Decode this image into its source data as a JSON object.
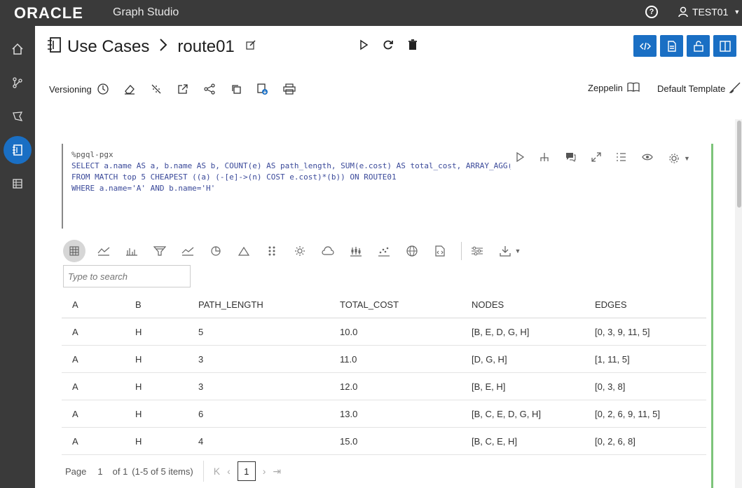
{
  "app": {
    "brand": "ORACLE",
    "product": "Graph Studio",
    "user": "TEST01"
  },
  "rail": {
    "items": [
      "home-icon",
      "graph-icon",
      "model-icon",
      "notebook-icon",
      "jobs-icon"
    ],
    "active_index": 3
  },
  "header": {
    "crumb_parent": "Use Cases",
    "crumb_current": "route01"
  },
  "toolbar": {
    "versioning_label": "Versioning",
    "zeppelin_label": "Zeppelin",
    "template_label": "Default Template"
  },
  "editor": {
    "lines": [
      "%pgql-pgx",
      "SELECT a.name AS a, b.name AS b, COUNT(e) AS path_length, SUM(e.cost) AS total_cost, ARRAY_AGG(...",
      "FROM MATCH top 5 CHEAPEST ((a) (-[e]->(n) COST e.cost)*(b)) ON ROUTE01",
      "WHERE a.name='A' AND b.name='H'"
    ]
  },
  "search": {
    "placeholder": "Type to search"
  },
  "table": {
    "columns": [
      "A",
      "B",
      "PATH_LENGTH",
      "TOTAL_COST",
      "NODES",
      "EDGES"
    ],
    "rows": [
      [
        "A",
        "H",
        "5",
        "10.0",
        "[B, E, D, G, H]",
        "[0, 3, 9, 11, 5]"
      ],
      [
        "A",
        "H",
        "3",
        "11.0",
        "[D, G, H]",
        "[1, 11, 5]"
      ],
      [
        "A",
        "H",
        "3",
        "12.0",
        "[B, E, H]",
        "[0, 3, 8]"
      ],
      [
        "A",
        "H",
        "6",
        "13.0",
        "[B, C, E, D, G, H]",
        "[0, 2, 6, 9, 11, 5]"
      ],
      [
        "A",
        "H",
        "4",
        "15.0",
        "[B, C, E, H]",
        "[0, 2, 6, 8]"
      ]
    ]
  },
  "pager": {
    "page_label": "Page",
    "page_value": "1",
    "of_label": "of 1",
    "items_label": "(1-5 of 5 items)",
    "current": "1"
  },
  "colors": {
    "accent": "#1a6fc4",
    "topbar": "#3a3a3a",
    "paragraph_border": "#7dc47a"
  }
}
